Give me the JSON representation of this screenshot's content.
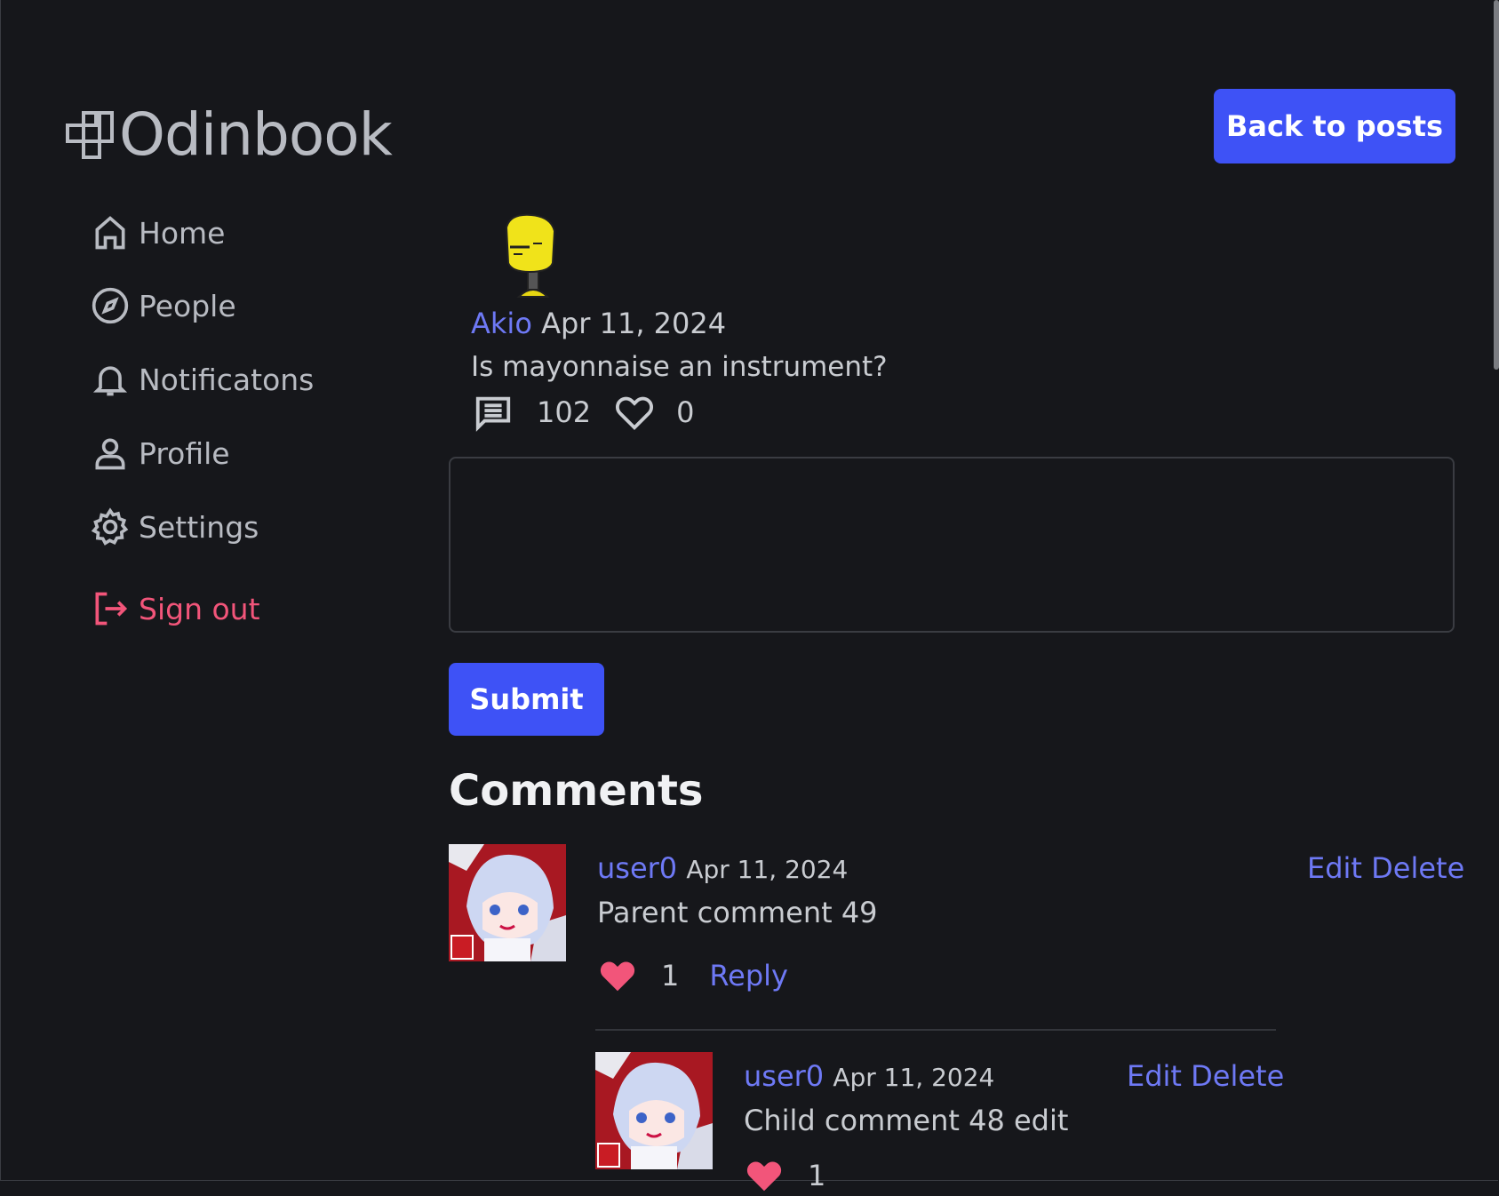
{
  "app": {
    "logo_text": "Odinbook",
    "back_button": "Back to posts"
  },
  "nav": {
    "items": [
      {
        "label": "Home",
        "icon": "home-icon"
      },
      {
        "label": "People",
        "icon": "compass-icon"
      },
      {
        "label": "Notificatons",
        "icon": "bell-icon"
      },
      {
        "label": "Profile",
        "icon": "person-icon"
      },
      {
        "label": "Settings",
        "icon": "gear-icon"
      },
      {
        "label": "Sign out",
        "icon": "sign-out-icon"
      }
    ]
  },
  "post": {
    "author": "Akio",
    "date": "Apr 11, 2024",
    "body": "Is mayonnaise an instrument?",
    "comment_count": "102",
    "like_count": "0"
  },
  "form": {
    "submit_label": "Submit",
    "textarea_value": ""
  },
  "comments": {
    "title": "Comments",
    "items": [
      {
        "author": "user0",
        "date": "Apr 11, 2024",
        "body": "Parent comment 49",
        "likes": "1",
        "reply_label": "Reply",
        "edit_label": "Edit",
        "delete_label": "Delete"
      },
      {
        "author": "user0",
        "date": "Apr 11, 2024",
        "body": "Child comment 48 edit",
        "likes": "1",
        "edit_label": "Edit",
        "delete_label": "Delete"
      }
    ]
  },
  "colors": {
    "background": "#16171b",
    "accent": "#3e52f6",
    "link": "#6e79f5",
    "danger": "#f2557a",
    "text": "#c9ccd1"
  }
}
